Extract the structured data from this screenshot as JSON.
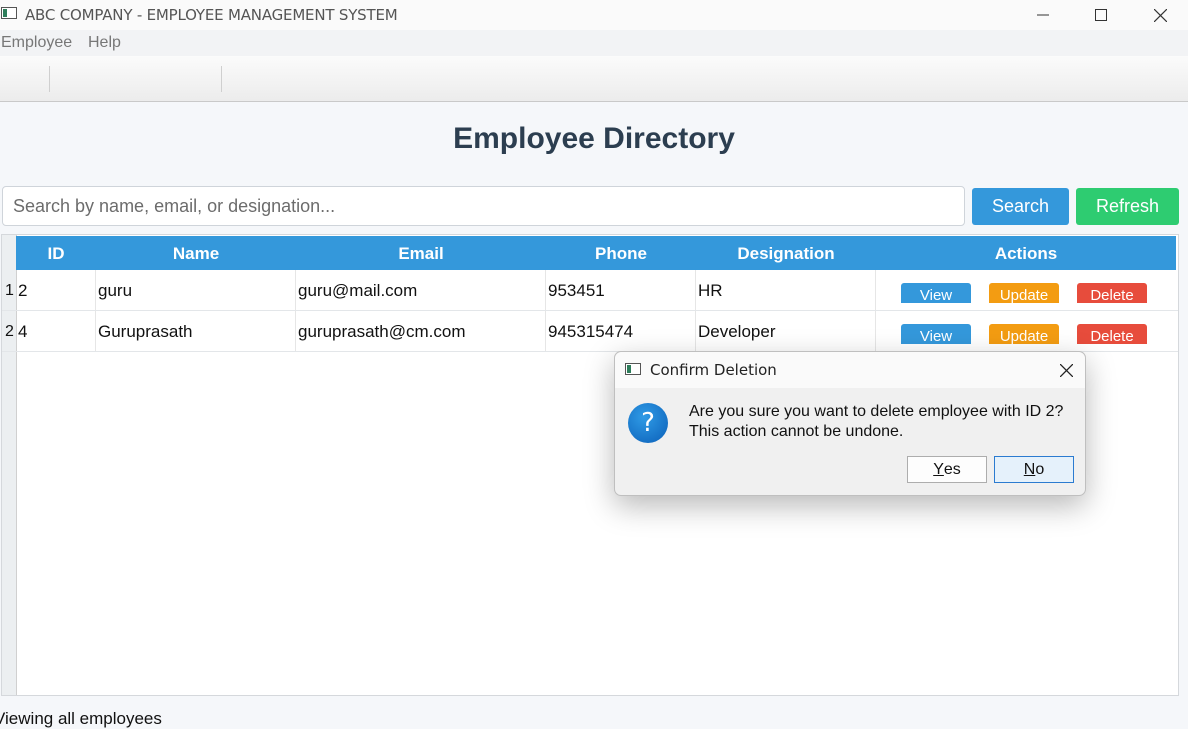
{
  "window": {
    "title": "ABC COMPANY - EMPLOYEE MANAGEMENT SYSTEM"
  },
  "menu": [
    "Employee",
    "Help"
  ],
  "page": {
    "title": "Employee Directory"
  },
  "search": {
    "placeholder": "Search by name, email, or designation...",
    "search_label": "Search",
    "refresh_label": "Refresh"
  },
  "table": {
    "columns": [
      "ID",
      "Name",
      "Email",
      "Phone",
      "Designation",
      "Actions"
    ],
    "rows": [
      {
        "num": "1",
        "id": "2",
        "name": "guru",
        "email": "guru@mail.com",
        "phone": "953451",
        "designation": "HR"
      },
      {
        "num": "2",
        "id": "4",
        "name": "Guruprasath",
        "email": "guruprasath@cm.com",
        "phone": "945315474",
        "designation": "Developer"
      }
    ],
    "actions": {
      "view": "View",
      "update": "Update",
      "delete": "Delete"
    }
  },
  "status": "Viewing all employees",
  "dialog": {
    "title": "Confirm Deletion",
    "message_line1": "Are you sure you want to delete employee with ID 2?",
    "message_line2": "This action cannot be undone.",
    "yes_first": "Y",
    "yes_rest": "es",
    "no_first": "N",
    "no_rest": "o"
  },
  "colors": {
    "header": "#3498db",
    "search_button": "#3498db",
    "refresh_button": "#2ecc71",
    "update_button": "#f39c12",
    "delete_button": "#e74c3c"
  }
}
